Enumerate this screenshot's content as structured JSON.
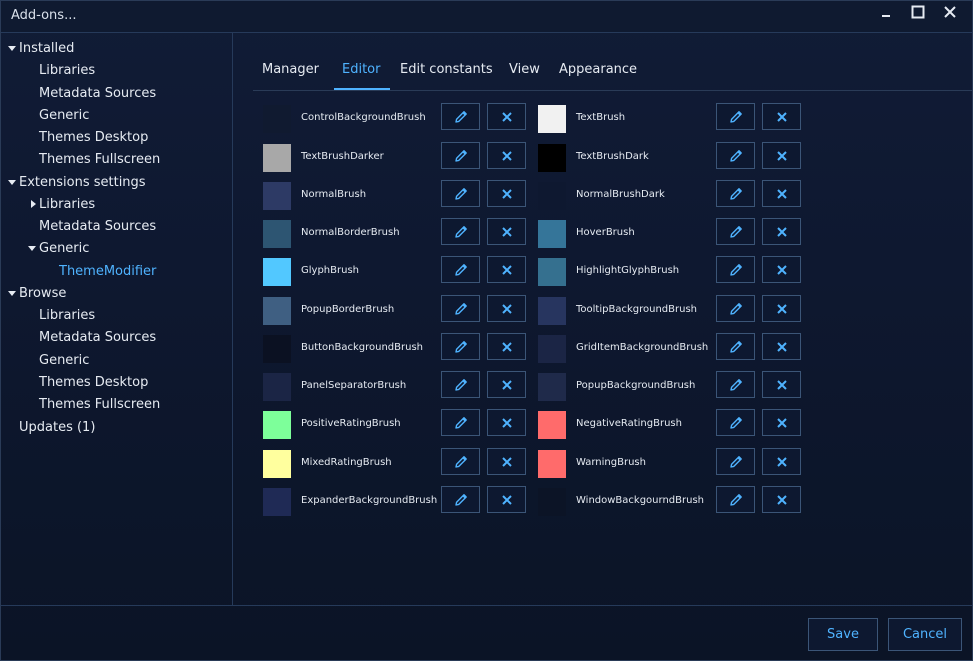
{
  "window": {
    "title": "Add-ons..."
  },
  "sidebar": {
    "installed": {
      "label": "Installed",
      "items": [
        "Libraries",
        "Metadata Sources",
        "Generic",
        "Themes Desktop",
        "Themes Fullscreen"
      ]
    },
    "extensions": {
      "label": "Extensions settings",
      "libraries": "Libraries",
      "metadata": "Metadata Sources",
      "generic": "Generic",
      "theme_modifier": "ThemeModifier"
    },
    "browse": {
      "label": "Browse",
      "items": [
        "Libraries",
        "Metadata Sources",
        "Generic",
        "Themes Desktop",
        "Themes Fullscreen"
      ]
    },
    "updates": "Updates (1)"
  },
  "tabs": [
    "Manager",
    "Editor",
    "Edit constants",
    "View",
    "Appearance"
  ],
  "active_tab": "Editor",
  "brushes_left": [
    {
      "name": "ControlBackgroundBrush",
      "color": "#101a30"
    },
    {
      "name": "TextBrushDarker",
      "color": "#a8a8a8"
    },
    {
      "name": "NormalBrush",
      "color": "#2d3a65"
    },
    {
      "name": "NormalBorderBrush",
      "color": "#2d5572"
    },
    {
      "name": "GlyphBrush",
      "color": "#52c8ff"
    },
    {
      "name": "PopupBorderBrush",
      "color": "#3f5f82"
    },
    {
      "name": "ButtonBackgroundBrush",
      "color": "#0b1122"
    },
    {
      "name": "PanelSeparatorBrush",
      "color": "#1b2545"
    },
    {
      "name": "PositiveRatingBrush",
      "color": "#7dff9a"
    },
    {
      "name": "MixedRatingBrush",
      "color": "#ffff9e"
    },
    {
      "name": "ExpanderBackgroundBrush",
      "color": "#1f2a55"
    }
  ],
  "brushes_right": [
    {
      "name": "TextBrush",
      "color": "#f1f1f1"
    },
    {
      "name": "TextBrushDark",
      "color": "#000000"
    },
    {
      "name": "NormalBrushDark",
      "color": "#0e1830"
    },
    {
      "name": "HoverBrush",
      "color": "#357599"
    },
    {
      "name": "HighlightGlyphBrush",
      "color": "#35708f"
    },
    {
      "name": "TooltipBackgroundBrush",
      "color": "#27355f"
    },
    {
      "name": "GridItemBackgroundBrush",
      "color": "#1b2545"
    },
    {
      "name": "PopupBackgroundBrush",
      "color": "#1f2a4a"
    },
    {
      "name": "NegativeRatingBrush",
      "color": "#ff6b6b"
    },
    {
      "name": "WarningBrush",
      "color": "#ff6b6b"
    },
    {
      "name": "WindowBackgourndBrush",
      "color": "#0c1426"
    }
  ],
  "footer": {
    "save": "Save",
    "cancel": "Cancel"
  },
  "colors": {
    "accent": "#4fb3ff",
    "border": "#3b5577"
  }
}
